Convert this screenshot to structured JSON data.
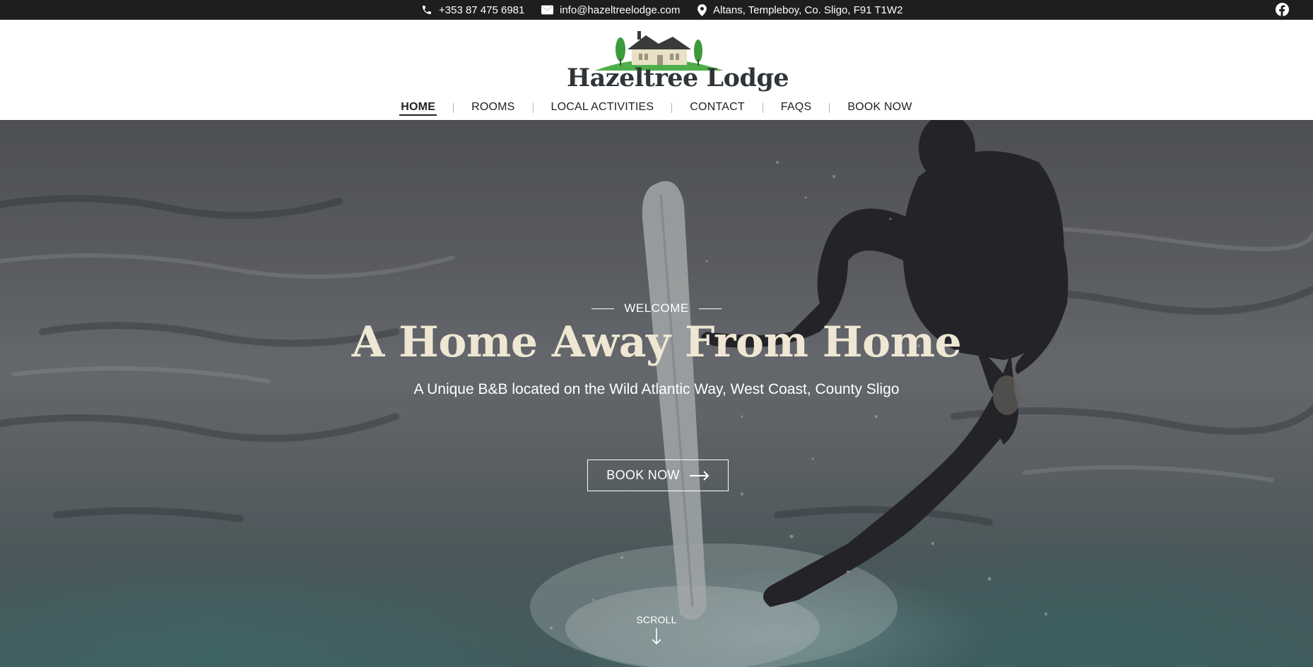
{
  "topbar": {
    "phone": "+353  87 475 6981",
    "email": "info@hazeltreelodge.com",
    "address": "Altans, Templeboy, Co. Sligo, F91 T1W2",
    "icons": [
      "phone-icon",
      "envelope-icon",
      "map-pin-icon",
      "facebook-icon"
    ]
  },
  "logo": {
    "text": "Hazeltree Lodge"
  },
  "nav": {
    "items": [
      {
        "label": "HOME",
        "active": true
      },
      {
        "label": "ROOMS"
      },
      {
        "label": "LOCAL ACTIVITIES"
      },
      {
        "label": "CONTACT"
      },
      {
        "label": "FAQS"
      },
      {
        "label": "BOOK NOW"
      }
    ]
  },
  "hero": {
    "eyebrow": "WELCOME",
    "title": "A Home Away From Home",
    "subtitle": "A Unique B&B located on the Wild Atlantic Way, West Coast, County Sligo",
    "cta_label": "BOOK NOW",
    "scroll_label": "SCROLL"
  },
  "colors": {
    "topbar_bg": "#1e1e1e",
    "headline": "#efe7d4",
    "logo_green": "#4fae4a",
    "logo_text": "#2f3538"
  }
}
